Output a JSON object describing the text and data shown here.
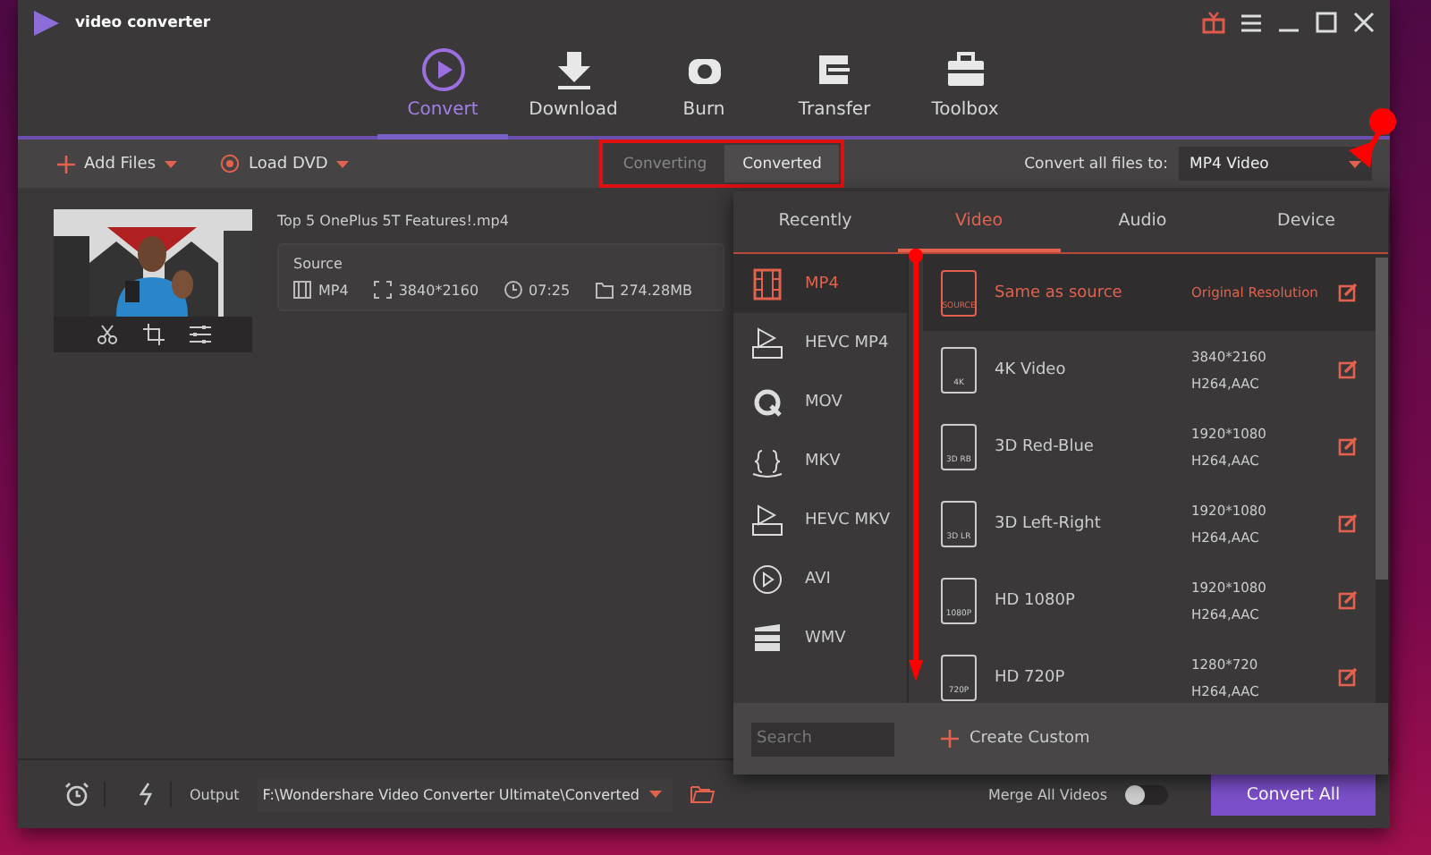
{
  "window": {
    "title": "video converter"
  },
  "nav_tabs": [
    {
      "label": "Convert",
      "selected": true
    },
    {
      "label": "Download",
      "selected": false
    },
    {
      "label": "Burn",
      "selected": false
    },
    {
      "label": "Transfer",
      "selected": false
    },
    {
      "label": "Toolbox",
      "selected": false
    }
  ],
  "toolbar": {
    "add_files": "Add Files",
    "load_dvd": "Load DVD",
    "view_tabs": [
      {
        "label": "Converting",
        "selected": false
      },
      {
        "label": "Converted",
        "selected": true
      }
    ],
    "convert_all_label": "Convert all files to:",
    "target_format": "MP4 Video"
  },
  "file": {
    "name": "Top 5 OnePlus 5T Features!.mp4",
    "source_label": "Source",
    "format": "MP4",
    "resolution": "3840*2160",
    "duration": "07:25",
    "size": "274.28MB"
  },
  "format_panel": {
    "tabs": [
      {
        "label": "Recently",
        "selected": false
      },
      {
        "label": "Video",
        "selected": true
      },
      {
        "label": "Audio",
        "selected": false
      },
      {
        "label": "Device",
        "selected": false
      }
    ],
    "formats": [
      {
        "label": "MP4",
        "kind": "film",
        "selected": true
      },
      {
        "label": "HEVC MP4",
        "kind": "hevc",
        "selected": false
      },
      {
        "label": "MOV",
        "kind": "mov",
        "selected": false
      },
      {
        "label": "MKV",
        "kind": "mkv",
        "selected": false
      },
      {
        "label": "HEVC MKV",
        "kind": "hevc",
        "selected": false
      },
      {
        "label": "AVI",
        "kind": "play",
        "selected": false
      },
      {
        "label": "WMV",
        "kind": "clapper",
        "selected": false
      }
    ],
    "presets": [
      {
        "badge": "SOURCE",
        "name": "Same as source",
        "resolution": "Original Resolution",
        "selected": true
      },
      {
        "badge": "4K",
        "name": "4K Video",
        "resolution": "3840*2160",
        "codec": "H264,AAC",
        "selected": false
      },
      {
        "badge": "3D RB",
        "name": "3D Red-Blue",
        "resolution": "1920*1080",
        "codec": "H264,AAC",
        "selected": false
      },
      {
        "badge": "3D LR",
        "name": "3D Left-Right",
        "resolution": "1920*1080",
        "codec": "H264,AAC",
        "selected": false
      },
      {
        "badge": "1080P",
        "name": "HD 1080P",
        "resolution": "1920*1080",
        "codec": "H264,AAC",
        "selected": false
      },
      {
        "badge": "720P",
        "name": "HD 720P",
        "resolution": "1280*720",
        "codec": "H264,AAC",
        "selected": false
      }
    ],
    "search": {
      "placeholder": "Search"
    },
    "create_custom": "Create Custom"
  },
  "bottom_bar": {
    "output_label": "Output",
    "output_path": "F:\\Wondershare Video Converter Ultimate\\Converted",
    "merge_label": "Merge All Videos",
    "merge_on": false,
    "convert_all": "Convert All"
  }
}
